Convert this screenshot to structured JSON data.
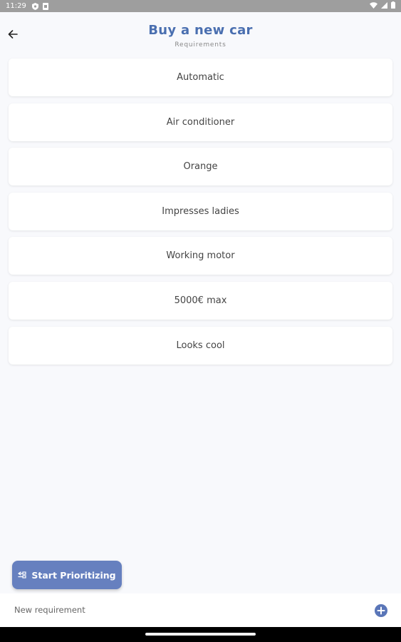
{
  "status_bar": {
    "time": "11:29",
    "icons": [
      "shield-icon",
      "sim-icon",
      "wifi-icon",
      "signal-icon",
      "battery-icon"
    ]
  },
  "header": {
    "title": "Buy a new car",
    "subtitle": "Requirements",
    "back_icon": "arrow-left-icon"
  },
  "requirements": [
    "Automatic",
    "Air conditioner",
    "Orange",
    "Impresses ladies",
    "Working motor",
    "5000€ max",
    "Looks cool"
  ],
  "fab": {
    "label": "Start Prioritizing",
    "icon": "compare-icon"
  },
  "new_requirement": {
    "placeholder": "New requirement",
    "value": "",
    "add_icon": "add-circle-icon"
  },
  "colors": {
    "accent": "#4a6fb0",
    "fab_bg": "#6680bf",
    "page_bg": "#f8f9fc",
    "card_bg": "#ffffff"
  }
}
